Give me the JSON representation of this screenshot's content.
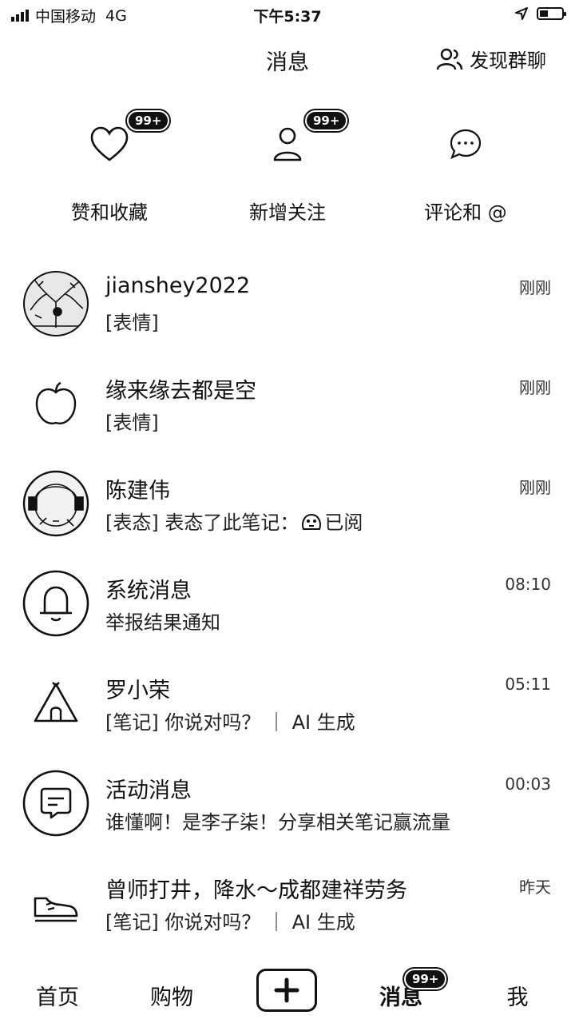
{
  "status": {
    "carrier": "中国移动",
    "network": "4G",
    "time": "下午5:37"
  },
  "header": {
    "title": "消息",
    "discover_label": "发现群聊"
  },
  "actions": [
    {
      "label": "赞和收藏",
      "badge": "99+",
      "icon": "heart-icon"
    },
    {
      "label": "新增关注",
      "badge": "99+",
      "icon": "person-icon"
    },
    {
      "label": "评论和 @",
      "badge": "",
      "icon": "chat-bubble-icon"
    }
  ],
  "messages": [
    {
      "name": "jianshey2022",
      "preview": "[表情]",
      "time": "刚刚",
      "avatar": "photo-avatar"
    },
    {
      "name": "缘来缘去都是空",
      "preview": "[表情]",
      "time": "刚刚",
      "avatar": "apple-icon"
    },
    {
      "name": "陈建伟",
      "preview": "[表态] 表态了此笔记：",
      "preview_suffix": "已阅",
      "time": "刚刚",
      "avatar": "photo-avatar"
    },
    {
      "name": "系统消息",
      "preview": "举报结果通知",
      "time": "08:10",
      "avatar": "bell-icon"
    },
    {
      "name": "罗小荣",
      "preview": "[笔记] 你说对吗？ ｜ AI 生成",
      "time": "05:11",
      "avatar": "tent-icon"
    },
    {
      "name": "活动消息",
      "preview": "谁懂啊！是李子柒！分享相关笔记赢流量",
      "time": "00:03",
      "avatar": "message-icon"
    },
    {
      "name": "曾师打井，降水～成都建祥劳务",
      "preview": "[笔记] 你说对吗？ ｜ AI 生成",
      "time": "昨天",
      "avatar": "sneaker-icon"
    }
  ],
  "tabs": {
    "home": "首页",
    "shop": "购物",
    "messages": "消息",
    "messages_badge": "99+",
    "me": "我"
  }
}
